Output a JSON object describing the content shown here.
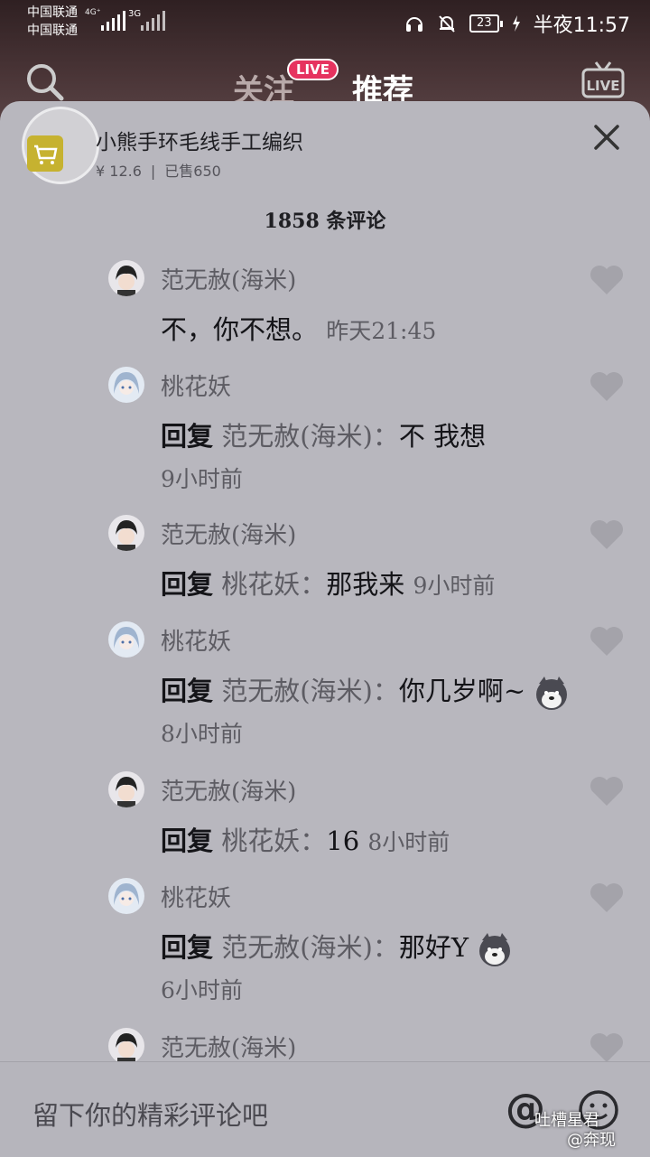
{
  "status": {
    "carrier1": "中国联通",
    "carrier2": "中国联通",
    "net1": "4G⁺",
    "net2": "3G",
    "battery": "23",
    "time": "半夜11:57"
  },
  "header": {
    "tab_follow": "关注",
    "tab_recommend": "推荐",
    "live_badge": "LIVE"
  },
  "product": {
    "title": "小熊手环毛线手工编织",
    "price": "¥ 12.6",
    "separator": "|",
    "sold": "已售650"
  },
  "comments_count": "1858 条评论",
  "comments": [
    {
      "user": "范无赦(海米)",
      "reply": "",
      "target": "",
      "text": "不，你不想。",
      "time": "昨天21:45"
    },
    {
      "user": "桃花妖",
      "reply": "回复",
      "target": "范无赦(海米)：",
      "text": "不 我想",
      "time": "9小时前"
    },
    {
      "user": "范无赦(海米)",
      "reply": "回复",
      "target": "桃花妖：",
      "text": "那我来",
      "time": "9小时前"
    },
    {
      "user": "桃花妖",
      "reply": "回复",
      "target": "范无赦(海米)：",
      "text": "你几岁啊~",
      "time": "8小时前"
    },
    {
      "user": "范无赦(海米)",
      "reply": "回复",
      "target": "桃花妖：",
      "text": "16",
      "time": "8小时前"
    },
    {
      "user": "桃花妖",
      "reply": "回复",
      "target": "范无赦(海米)：",
      "text": "那好Y",
      "time": "6小时前"
    },
    {
      "user": "范无赦(海米)"
    }
  ],
  "input": {
    "placeholder": "留下你的精彩评论吧",
    "at": "@"
  },
  "watermark": {
    "line1": "吐槽星君",
    "line2": "@奔现"
  },
  "colors": {
    "sheet_bg": "#b8b7be",
    "live_badge": "#e6335f",
    "cart": "#c6b230"
  }
}
